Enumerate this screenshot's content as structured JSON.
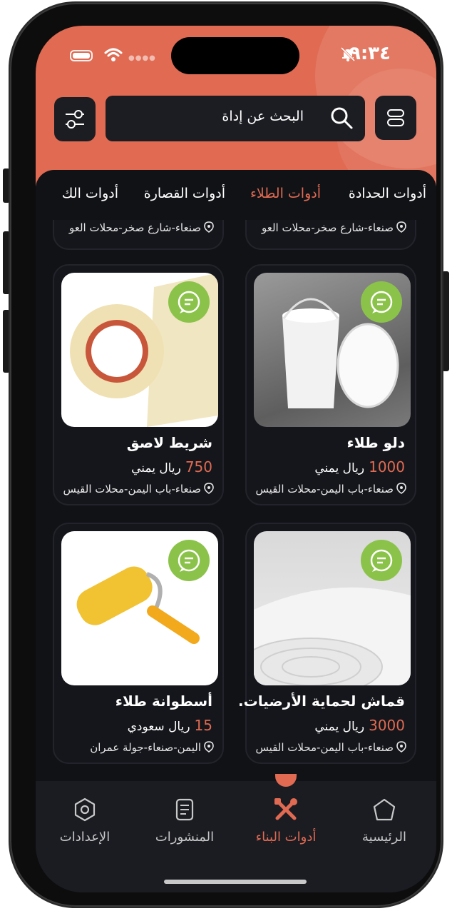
{
  "status": {
    "time": "٩:٣٤"
  },
  "search": {
    "placeholder": "البحث عن إداة"
  },
  "tabs": [
    {
      "label": "أدوات الحدادة",
      "active": false
    },
    {
      "label": "أدوات الطلاء",
      "active": true
    },
    {
      "label": "أدوات القصارة",
      "active": false
    },
    {
      "label": "أدوات الك",
      "active": false
    }
  ],
  "partial_cards": [
    {
      "location": "صنعاء-شارع صخر-محلات العو"
    },
    {
      "location": "صنعاء-شارع صخر-محلات العو"
    }
  ],
  "products": [
    {
      "title": "دلو طلاء",
      "price": "1000",
      "currency": "ريال يمني",
      "location": "صنعاء-باب اليمن-محلات القيس",
      "image": "white-bucket"
    },
    {
      "title": "شريط لاصق",
      "price": "750",
      "currency": "ريال يمني",
      "location": "صنعاء-باب اليمن-محلات القيس",
      "image": "tape-roll"
    },
    {
      "title": "قماش لحماية الأرضيات.",
      "price": "3000",
      "currency": "ريال يمني",
      "location": "صنعاء-باب اليمن-محلات القيس",
      "image": "fabric-roll"
    },
    {
      "title": "أسطوانة طلاء",
      "price": "15",
      "currency": "ريال سعودي",
      "location": "اليمن-صنعاء-جولة عمران",
      "image": "paint-roller"
    }
  ],
  "nav": [
    {
      "label": "الرئيسية",
      "icon": "home-icon",
      "active": false
    },
    {
      "label": "أدوات البناء",
      "icon": "tools-icon",
      "active": true
    },
    {
      "label": "المنشورات",
      "icon": "posts-icon",
      "active": false
    },
    {
      "label": "الإعدادات",
      "icon": "settings-icon",
      "active": false
    }
  ],
  "colors": {
    "accent": "#e06a52",
    "chat": "#8bc34a",
    "background": "#111216"
  }
}
